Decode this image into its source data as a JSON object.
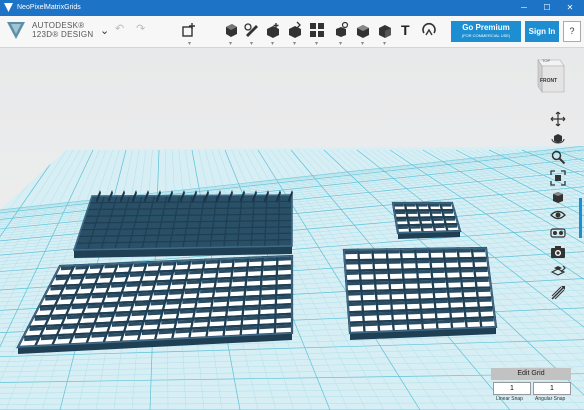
{
  "window": {
    "title": "NeoPixelMatrixGrids",
    "minimize": "─",
    "maximize": "☐",
    "close": "✕"
  },
  "brand": {
    "line1": "AUTODESK®",
    "line2": "123D® DESIGN"
  },
  "toolbar": {
    "menu_chevron": "⌄",
    "undo": "↶",
    "redo": "↷",
    "text_tool": "T",
    "tools": [
      "new-shape",
      "primitives",
      "sketch",
      "construct",
      "modify",
      "pattern",
      "group",
      "combine",
      "measure",
      "text",
      "snap"
    ]
  },
  "premium": {
    "label": "Go Premium",
    "sublabel": "(FOR COMMERCIAL USE)"
  },
  "signin": {
    "label": "Sign In"
  },
  "help": {
    "label": "?"
  },
  "viewcube": {
    "top": "TOP",
    "front": "FRONT"
  },
  "navigation": [
    "pan",
    "orbit",
    "zoom",
    "fit",
    "view",
    "visibility",
    "material",
    "screenshot",
    "grid-settings",
    "snap-settings"
  ],
  "edit_grid": {
    "label": "Edit Grid",
    "linear_snap": "1",
    "angular_snap": "1",
    "linear_label": "Linear Snap",
    "angular_label": "Angular Snap"
  },
  "scene": {
    "objects": [
      {
        "name": "grid-16x8-unassembled",
        "rows": 8,
        "cols": 16
      },
      {
        "name": "grid-16x8-assembled",
        "rows": 8,
        "cols": 16
      },
      {
        "name": "grid-5x4",
        "rows": 4,
        "cols": 5
      },
      {
        "name": "grid-10x8",
        "rows": 8,
        "cols": 10
      }
    ],
    "colors": {
      "object": "#1f3f54",
      "object_top": "#3f6b87",
      "grid_major": "#5cc2d7",
      "grid_minor": "#a7dde8"
    }
  }
}
